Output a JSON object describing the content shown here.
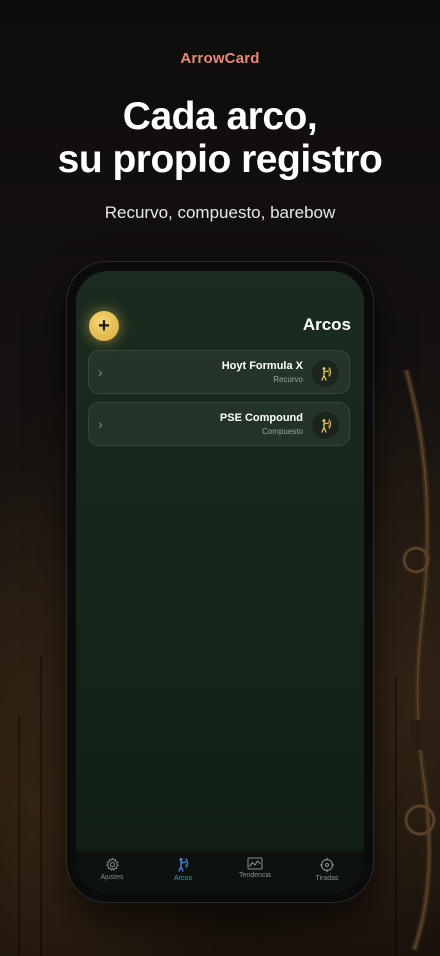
{
  "brand": "ArrowCard",
  "headline": {
    "line1": "Cada arco,",
    "line2": "su propio registro"
  },
  "subheadline": "Recurvo, compuesto, barebow",
  "screen": {
    "title": "Arcos",
    "add_label": "+",
    "bows": [
      {
        "name": "Hoyt Formula X",
        "type": "Recurvo",
        "icon": "archer-icon"
      },
      {
        "name": "PSE Compound",
        "type": "Compuesto",
        "icon": "archer-icon"
      }
    ]
  },
  "tabbar": {
    "active": "Arcos",
    "tabs": [
      {
        "label": "Ajustes",
        "icon": "gear-icon"
      },
      {
        "label": "Arcos",
        "icon": "archer-icon"
      },
      {
        "label": "Tendencia",
        "icon": "chart-icon"
      },
      {
        "label": "Tiradas",
        "icon": "target-icon"
      }
    ]
  },
  "colors": {
    "brand": "#e58a78",
    "accent_gold": "#e8c25a",
    "tab_active": "#4a8cf2",
    "screen_bg": "#17271b"
  }
}
